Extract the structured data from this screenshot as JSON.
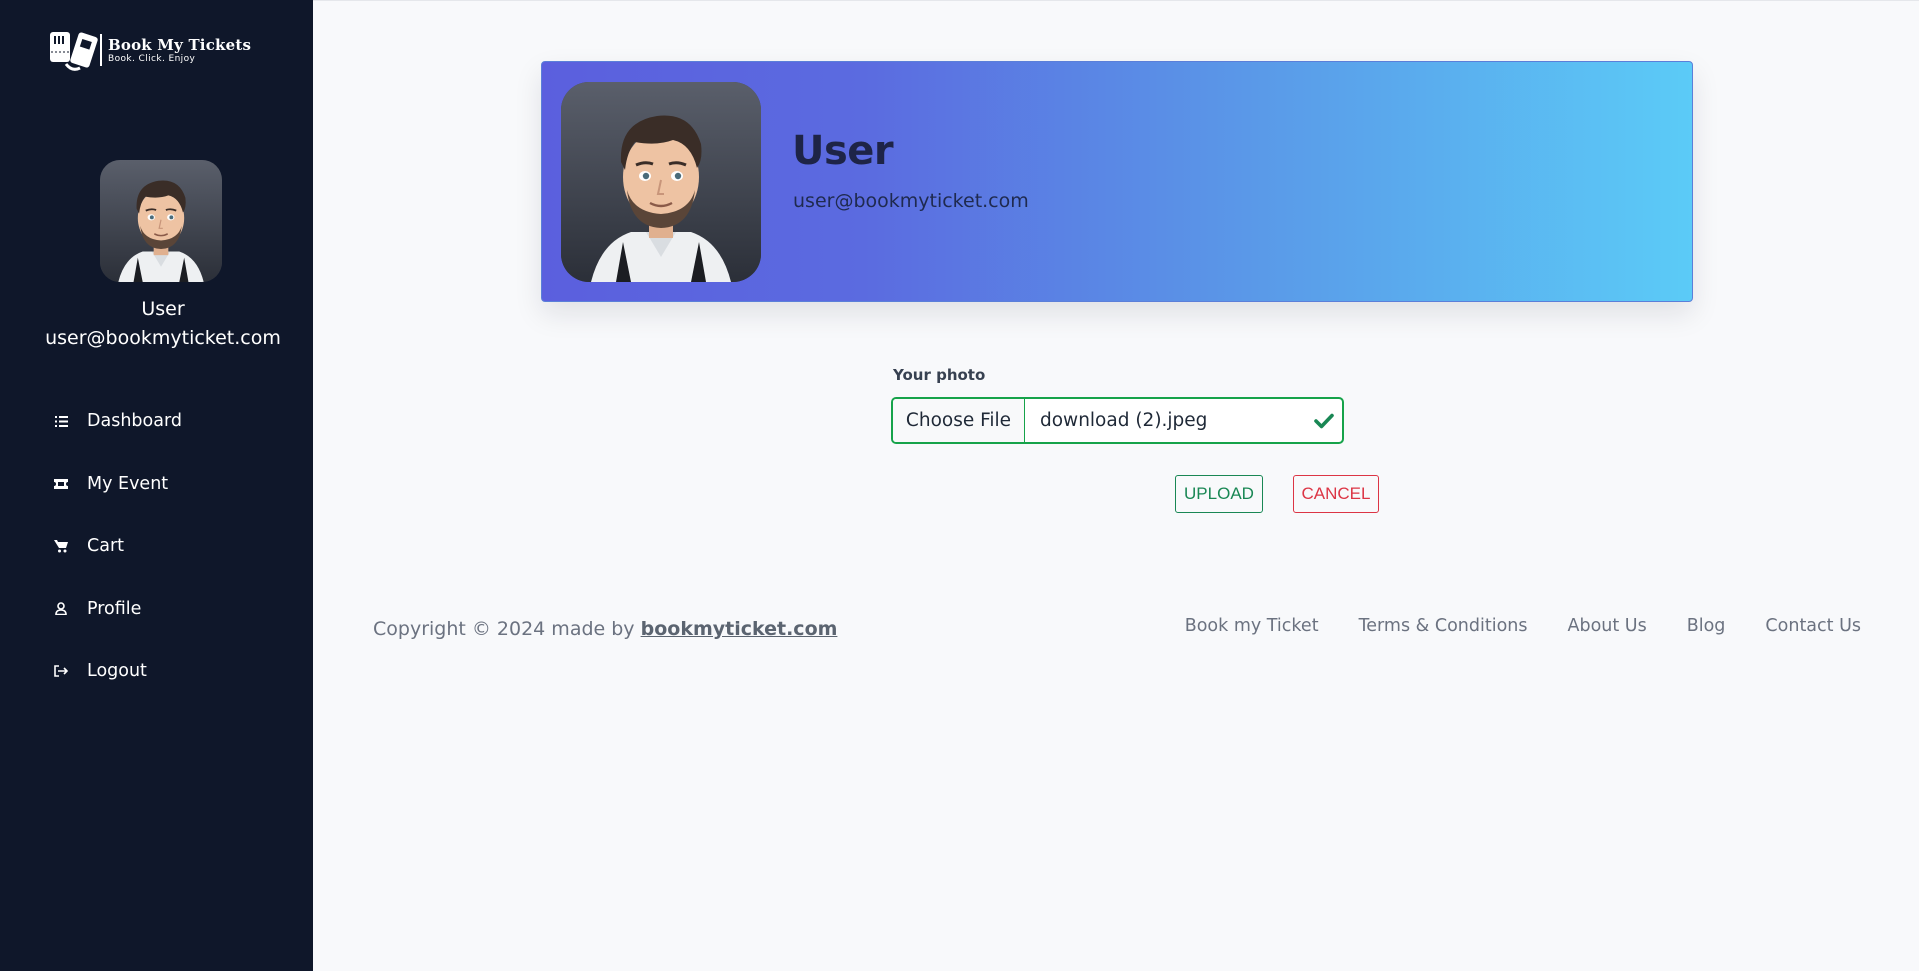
{
  "brand": {
    "title": "Book My Tickets",
    "tagline": "Book. Click. Enjoy"
  },
  "user": {
    "name": "User",
    "email": "user@bookmyticket.com"
  },
  "sidebar": {
    "items": [
      {
        "label": "Dashboard",
        "icon": "list-icon"
      },
      {
        "label": "My Event",
        "icon": "ticket-icon"
      },
      {
        "label": "Cart",
        "icon": "cart-icon"
      },
      {
        "label": "Profile",
        "icon": "user-icon"
      },
      {
        "label": "Logout",
        "icon": "logout-icon"
      }
    ]
  },
  "upload": {
    "label": "Your photo",
    "choose_label": "Choose File",
    "file_name": "download (2).jpeg",
    "upload_label": "UPLOAD",
    "cancel_label": "CANCEL"
  },
  "footer": {
    "copyright_prefix": "Copyright © 2024 made by ",
    "copyright_link": "bookmyticket.com",
    "links": [
      "Book my Ticket",
      "Terms & Conditions",
      "About Us",
      "Blog",
      "Contact Us"
    ]
  },
  "colors": {
    "sidebar_bg": "#0f172a",
    "success": "#198754",
    "danger": "#dc3545",
    "banner_start": "#5b5fde",
    "banner_end": "#5bcbf7"
  }
}
